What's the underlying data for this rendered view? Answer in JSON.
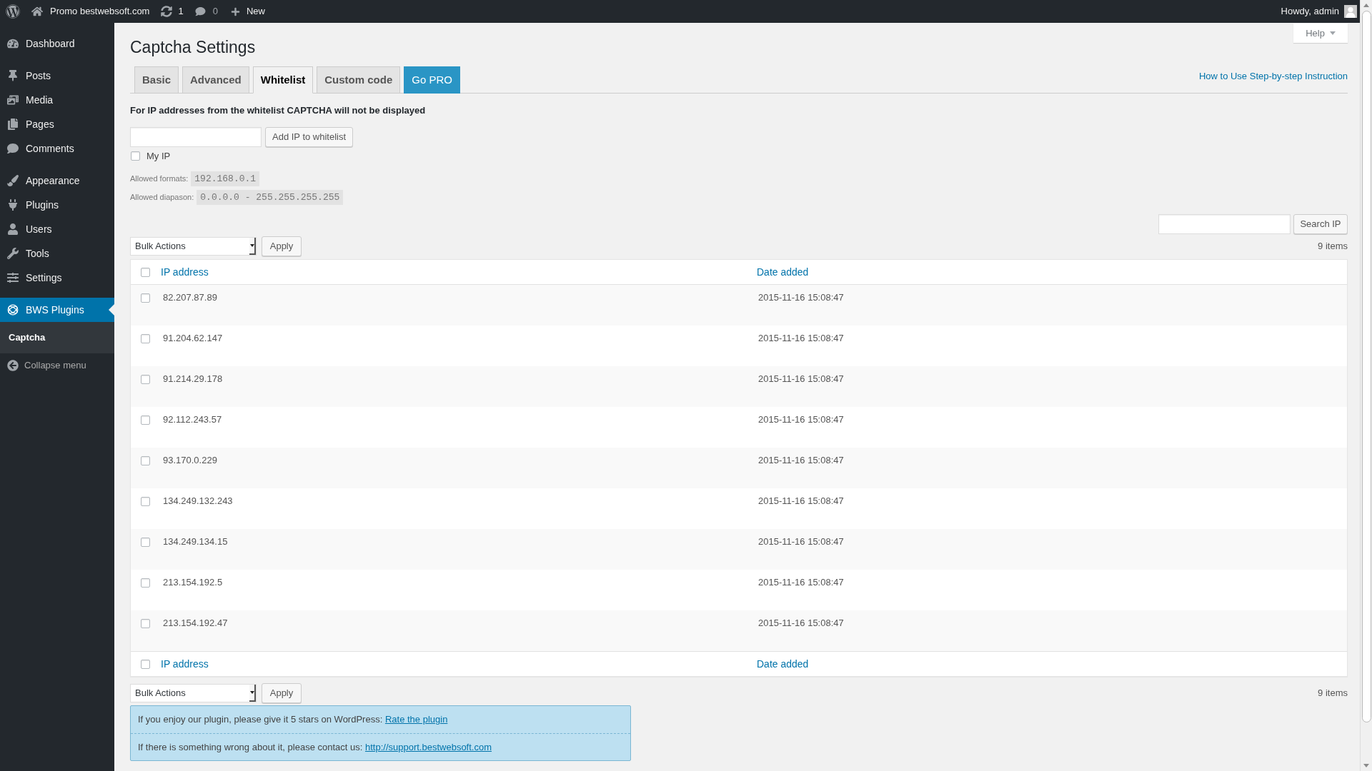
{
  "admin_bar": {
    "site_name": "Promo bestwebsoft.com",
    "updates_count": "1",
    "comments_count": "0",
    "new_label": "New",
    "greeting": "Howdy, admin"
  },
  "sidebar": {
    "sections": [
      {
        "items": [
          {
            "label": "Dashboard",
            "selected": false
          }
        ]
      },
      {
        "items": [
          {
            "label": "Posts",
            "selected": false
          },
          {
            "label": "Media",
            "selected": false
          },
          {
            "label": "Pages",
            "selected": false
          },
          {
            "label": "Comments",
            "selected": false
          }
        ]
      },
      {
        "items": [
          {
            "label": "Appearance",
            "selected": false
          },
          {
            "label": "Plugins",
            "selected": false
          },
          {
            "label": "Users",
            "selected": false
          },
          {
            "label": "Tools",
            "selected": false
          },
          {
            "label": "Settings",
            "selected": false
          }
        ]
      },
      {
        "items": [
          {
            "label": "BWS Plugins",
            "selected": true,
            "children": [
              {
                "label": "Captcha",
                "selected": true
              }
            ]
          }
        ]
      }
    ],
    "collapse_label": "Collapse menu"
  },
  "header": {
    "title": "Captcha Settings",
    "help_label": "Help",
    "instruction_link": "How to Use Step-by-step Instruction"
  },
  "tabs": [
    {
      "label": "Basic",
      "selected": false,
      "kind": "tab"
    },
    {
      "label": "Advanced",
      "selected": false,
      "kind": "tab"
    },
    {
      "label": "Whitelist",
      "selected": true,
      "kind": "tab"
    },
    {
      "label": "Custom code",
      "selected": false,
      "kind": "tab"
    },
    {
      "label": "Go PRO",
      "selected": false,
      "kind": "promo"
    }
  ],
  "whitelist_form": {
    "description": "For IP addresses from the whitelist CAPTCHA will not be displayed",
    "add_button": "Add IP to whitelist",
    "my_ip": {
      "label": "My IP",
      "checked": false
    },
    "hints": [
      {
        "label": "Allowed formats:",
        "value": "192.168.0.1"
      },
      {
        "label": "Allowed diapason:",
        "value": "0.0.0.0 - 255.255.255.255"
      }
    ]
  },
  "search": {
    "button_label": "Search IP"
  },
  "top_nav": {
    "bulk_actions": "Bulk Actions",
    "apply_label": "Apply",
    "count": "9 items"
  },
  "table": {
    "header": {
      "checked": false,
      "columns": [
        "IP address",
        "Date added"
      ]
    },
    "rows": [
      {
        "ip": "82.207.87.89",
        "date": "2015-11-16 15:08:47",
        "checked": false
      },
      {
        "ip": "91.204.62.147",
        "date": "2015-11-16 15:08:47",
        "checked": false
      },
      {
        "ip": "91.214.29.178",
        "date": "2015-11-16 15:08:47",
        "checked": false
      },
      {
        "ip": "92.112.243.57",
        "date": "2015-11-16 15:08:47",
        "checked": false
      },
      {
        "ip": "93.170.0.229",
        "date": "2015-11-16 15:08:47",
        "checked": false
      },
      {
        "ip": "134.249.132.243",
        "date": "2015-11-16 15:08:47",
        "checked": false
      },
      {
        "ip": "134.249.134.15",
        "date": "2015-11-16 15:08:47",
        "checked": false
      },
      {
        "ip": "213.154.192.5",
        "date": "2015-11-16 15:08:47",
        "checked": false
      },
      {
        "ip": "213.154.192.47",
        "date": "2015-11-16 15:08:47",
        "checked": false
      }
    ],
    "footer": {
      "checked": false,
      "columns": [
        "IP address",
        "Date added"
      ]
    }
  },
  "bottom_nav": {
    "bulk_actions": "Bulk Actions",
    "apply_label": "Apply",
    "count": "9 items"
  },
  "notice": {
    "lines": [
      {
        "text": "If you enjoy our plugin, please give it 5 stars on WordPress:",
        "link": "Rate the plugin"
      },
      {
        "text": "If there is something wrong about it, please contact us:",
        "link": "http://support.bestwebsoft.com"
      }
    ]
  }
}
